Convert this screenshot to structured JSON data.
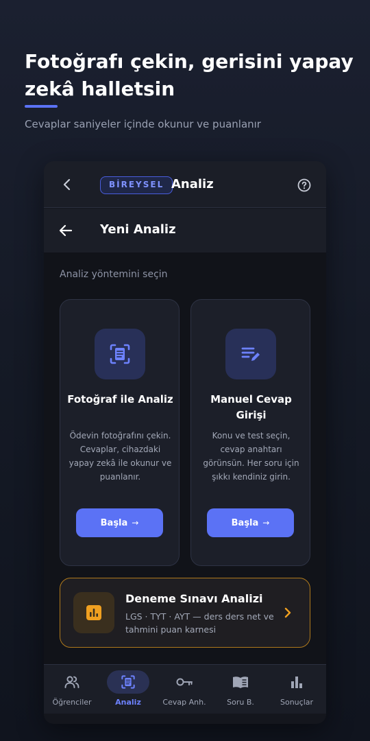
{
  "hero": {
    "headline": "Fotoğrafı çekin, gerisini yapay zekâ halletsin",
    "subtitle": "Cevaplar saniyeler içinde okunur ve puanlanır"
  },
  "appbar": {
    "badge": "BİREYSEL",
    "title": "Analiz",
    "back_icon": "chevron-left-icon",
    "help_icon": "help-circle-icon"
  },
  "subbar": {
    "title": "Yeni Analiz",
    "back_icon": "arrow-left-icon"
  },
  "content": {
    "section_label": "Analiz yöntemini seçin",
    "cards": [
      {
        "icon": "scan-document-icon",
        "title": "Fotoğraf ile Analiz",
        "description": "Ödevin fotoğrafını çekin. Cevaplar, cihazdaki yapay zekâ ile okunur ve puanlanır.",
        "button_label": "Başla",
        "button_arrow": "→"
      },
      {
        "icon": "edit-list-icon",
        "title": "Manuel Cevap Girişi",
        "description": "Konu ve test seçin, cevap anahtarı görünsün. Her soru için şıkkı kendiniz girin.",
        "button_label": "Başla",
        "button_arrow": "→"
      }
    ],
    "exam": {
      "icon": "bar-chart-icon",
      "title": "Deneme Sınavı Analizi",
      "description": "LGS · TYT · AYT — ders ders net ve tahmini puan karnesi",
      "chevron_icon": "chevron-right-icon"
    }
  },
  "nav": {
    "items": [
      {
        "label": "Öğrenciler",
        "icon": "users-icon",
        "active": false
      },
      {
        "label": "Analiz",
        "icon": "scan-document-icon",
        "active": true
      },
      {
        "label": "Cevap Anh.",
        "icon": "key-icon",
        "active": false
      },
      {
        "label": "Soru B.",
        "icon": "book-icon",
        "active": false
      },
      {
        "label": "Sonuçlar",
        "icon": "bar-chart-icon",
        "active": false
      }
    ]
  },
  "colors": {
    "accent": "#5b72f5",
    "exam_border": "#b07a1c",
    "exam_icon": "#f0a020"
  }
}
